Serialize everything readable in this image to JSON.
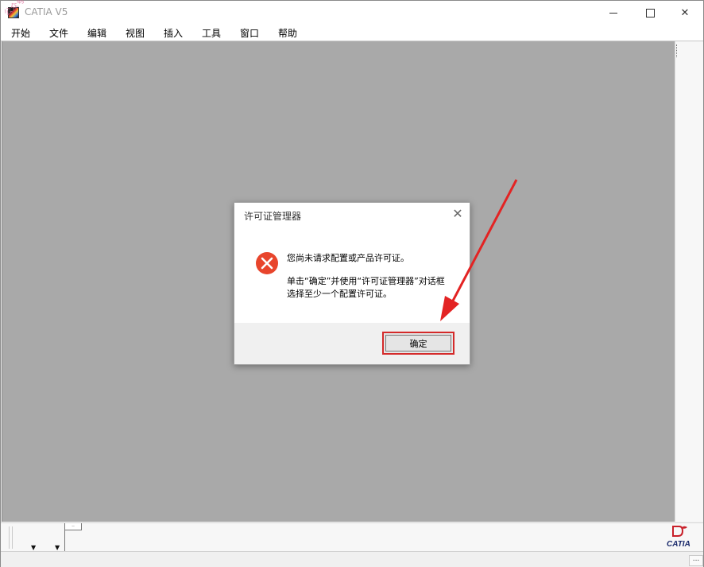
{
  "app": {
    "title": "CATIA V5",
    "watermark": "公众号:软件设计"
  },
  "menu": [
    "开始",
    "文件",
    "编辑",
    "视图",
    "插入",
    "工具",
    "窗口",
    "帮助"
  ],
  "dialog": {
    "title": "许可证管理器",
    "message_line1": "您尚未请求配置或产品许可证。",
    "message_line2": "单击“确定”并使用“许可证管理器”对话框",
    "message_line3": "选择至少一个配置许可证。",
    "ok_label": "确定",
    "icon": "error-icon"
  },
  "status": {
    "ellipsis": "..."
  },
  "logo": {
    "text": "CATIA",
    "ds": "DS"
  },
  "colors": {
    "workspace": "#a9a9a9",
    "highlight": "#d42a2a",
    "error": "#e8452c"
  }
}
